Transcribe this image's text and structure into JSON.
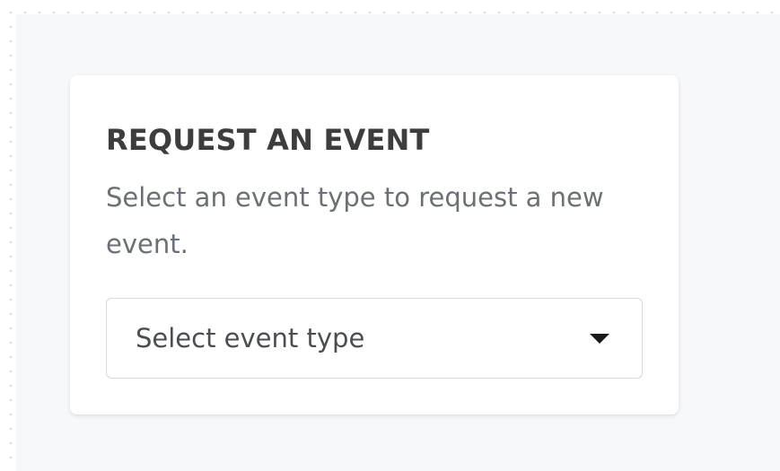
{
  "card": {
    "title": "REQUEST AN EVENT",
    "description": "Select an event type to request a new event.",
    "select": {
      "placeholder": "Select event type",
      "icon": "caret-down-icon"
    }
  }
}
